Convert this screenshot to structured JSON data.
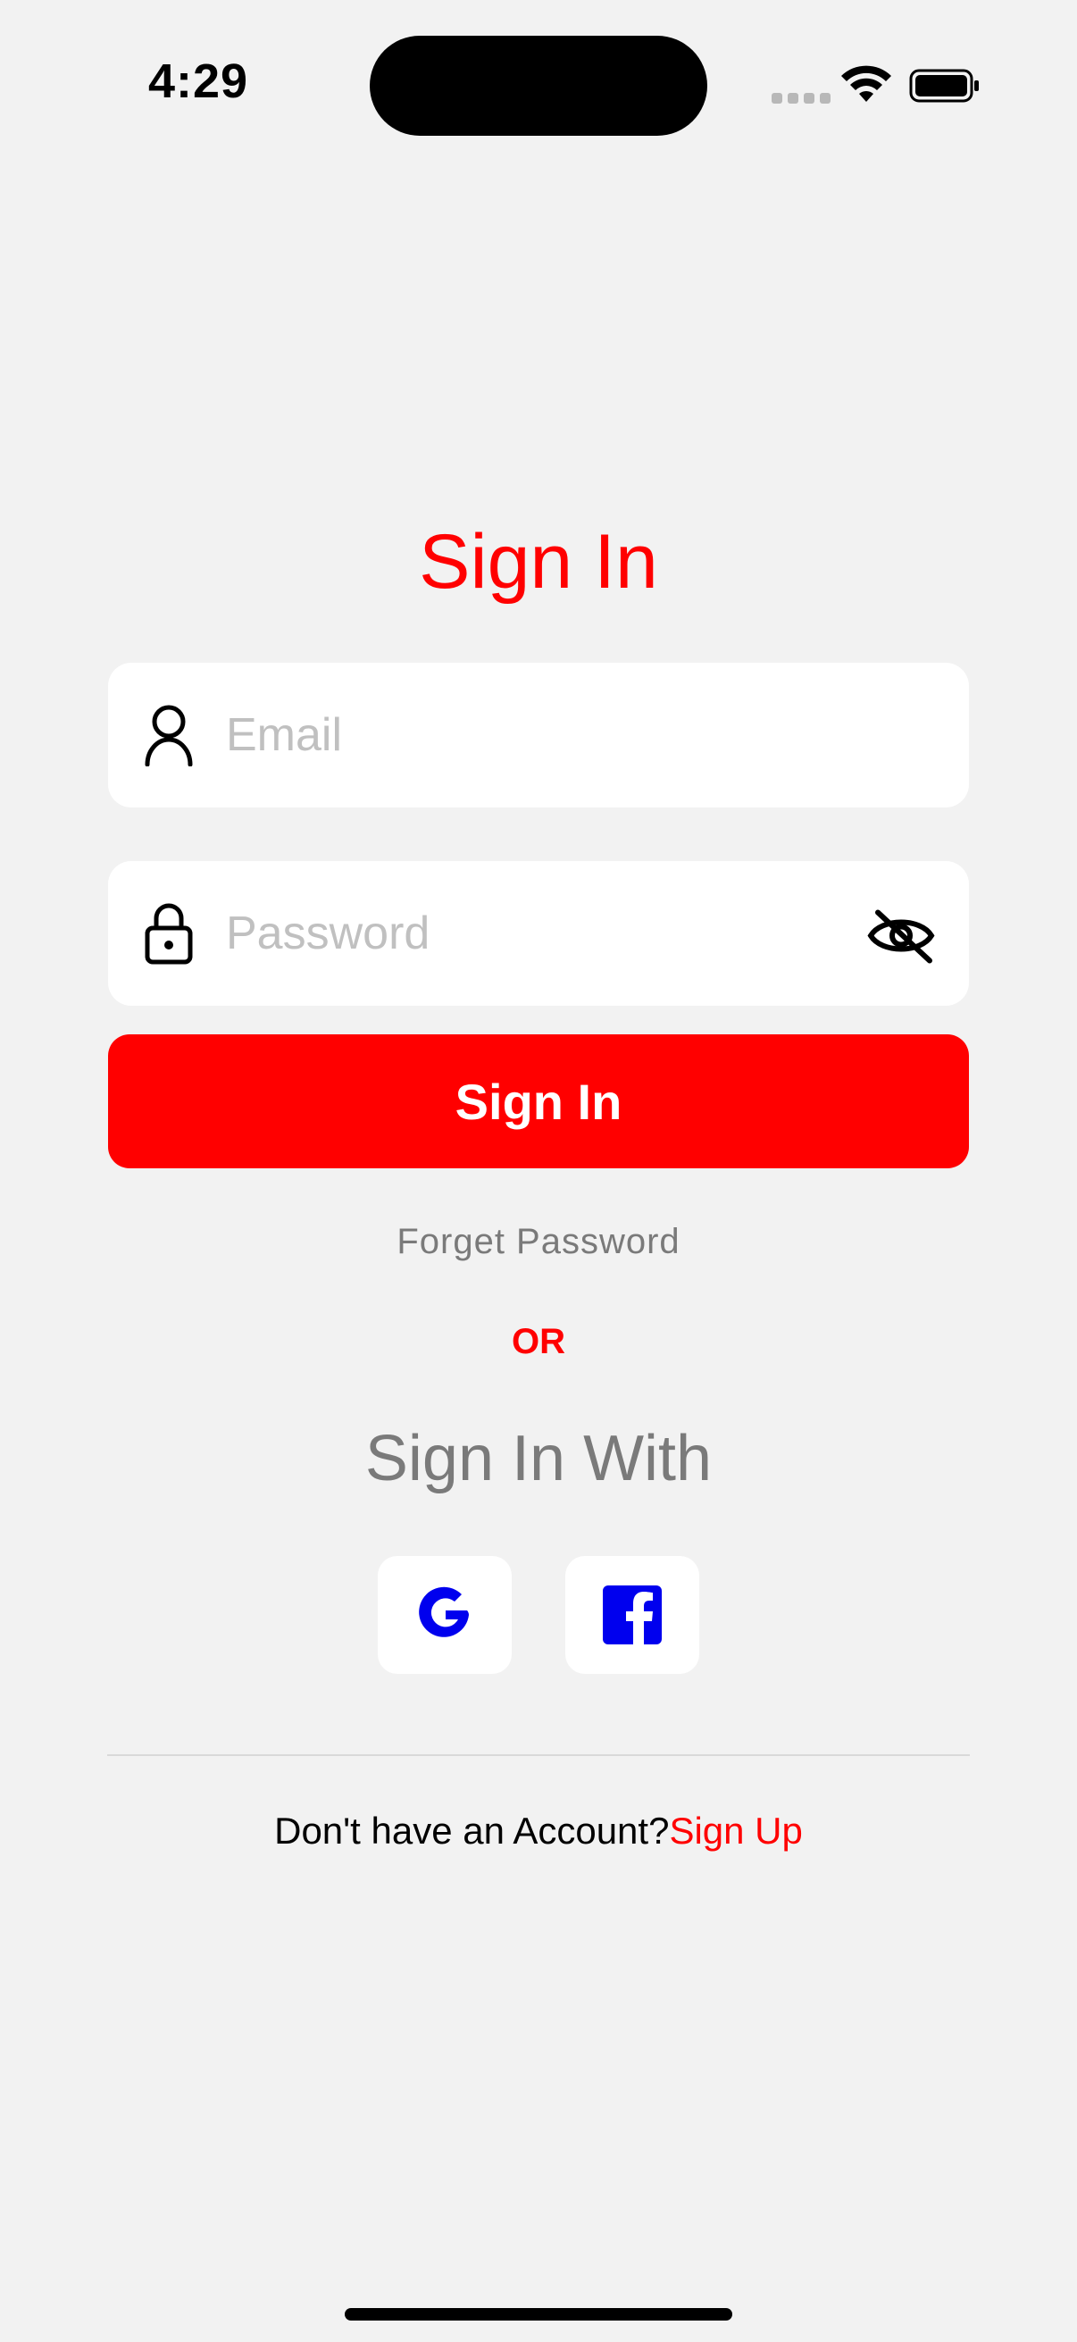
{
  "status_bar": {
    "time": "4:29"
  },
  "screen": {
    "title": "Sign In",
    "email": {
      "placeholder": "Email",
      "icon": "person-icon"
    },
    "password": {
      "placeholder": "Password",
      "icon": "lock-icon",
      "toggle_icon": "eye-slash-icon"
    },
    "sign_in_button": "Sign In",
    "forget_password": "Forget Password",
    "or_text": "OR",
    "sign_in_with": "Sign In With",
    "social": [
      "google-icon",
      "facebook-icon"
    ],
    "no_account": "Don't have an Account?",
    "sign_up": "Sign Up"
  },
  "colors": {
    "accent": "#ff0000",
    "background": "#f2f2f2",
    "social_icon": "#0000ee",
    "muted_text": "#7a7a7a"
  }
}
